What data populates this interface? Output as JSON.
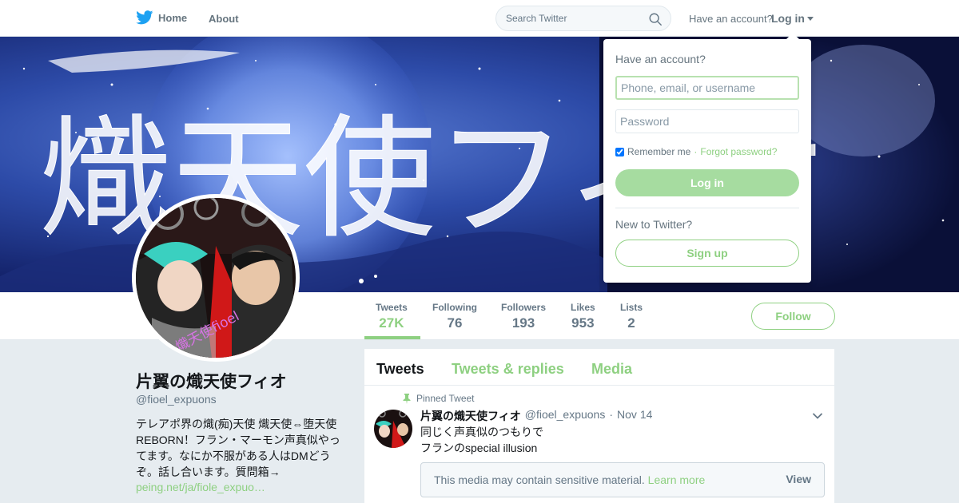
{
  "nav": {
    "home_label": "Home",
    "about_label": "About",
    "search_placeholder": "Search Twitter",
    "have_account": "Have an account?",
    "login_label": "Log in"
  },
  "banner": {
    "calligraphy_text": "熾天使フィオ"
  },
  "profile": {
    "name": "片翼の熾天使フィオ",
    "handle": "@fioel_expuons",
    "bio_lines": [
      "テレアポ界の熾(痴)天使 熾天使⇔堕天使",
      "REBORN！フラン・マーモン声真似やっ",
      "てます。なにか不服がある人はDMどう",
      "ぞ。話し合います。質問箱→"
    ],
    "link": "peing.net/ja/fiole_expuo…",
    "avatar_overlay_text": "熾天使fioel"
  },
  "stats": [
    {
      "label": "Tweets",
      "value": "27K"
    },
    {
      "label": "Following",
      "value": "76"
    },
    {
      "label": "Followers",
      "value": "193"
    },
    {
      "label": "Likes",
      "value": "953"
    },
    {
      "label": "Lists",
      "value": "2"
    }
  ],
  "follow_label": "Follow",
  "tabs": [
    "Tweets",
    "Tweets & replies",
    "Media"
  ],
  "tweet": {
    "pinned_label": "Pinned Tweet",
    "name": "片翼の熾天使フィオ",
    "handle": "@fioel_expuons",
    "sep": "·",
    "date": "Nov 14",
    "lines": [
      "同じく声真似のつもりで",
      "フランのspecial illusion"
    ],
    "sensitive_text": "This media may contain sensitive material.",
    "learn_more": "Learn more",
    "view_label": "View"
  },
  "login_dropdown": {
    "title": "Have an account?",
    "username_placeholder": "Phone, email, or username",
    "password_placeholder": "Password",
    "remember_label": "Remember me",
    "dot": "·",
    "forgot_label": "Forgot password?",
    "login_button": "Log in",
    "new_label": "New to Twitter?",
    "signup_button": "Sign up"
  },
  "colors": {
    "accent": "#8ed081",
    "twitter_blue": "#1da1f2",
    "text_muted": "#657786"
  }
}
